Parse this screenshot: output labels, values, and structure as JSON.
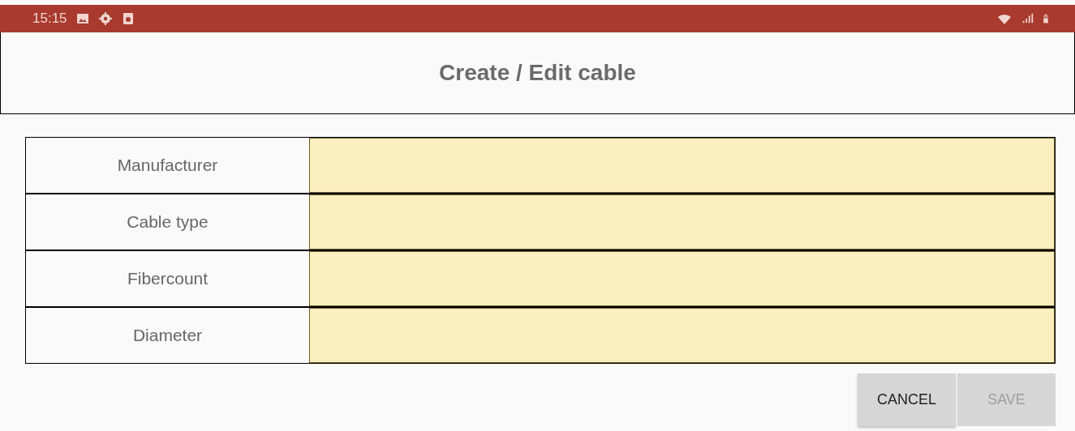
{
  "status_bar": {
    "time": "15:15"
  },
  "header": {
    "title": "Create / Edit cable"
  },
  "fields": [
    {
      "label": "Manufacturer"
    },
    {
      "label": "Cable type"
    },
    {
      "label": "Fibercount"
    },
    {
      "label": "Diameter"
    }
  ],
  "buttons": [
    {
      "label": "CANCEL",
      "disabled": false
    },
    {
      "label": "SAVE",
      "disabled": true
    }
  ]
}
